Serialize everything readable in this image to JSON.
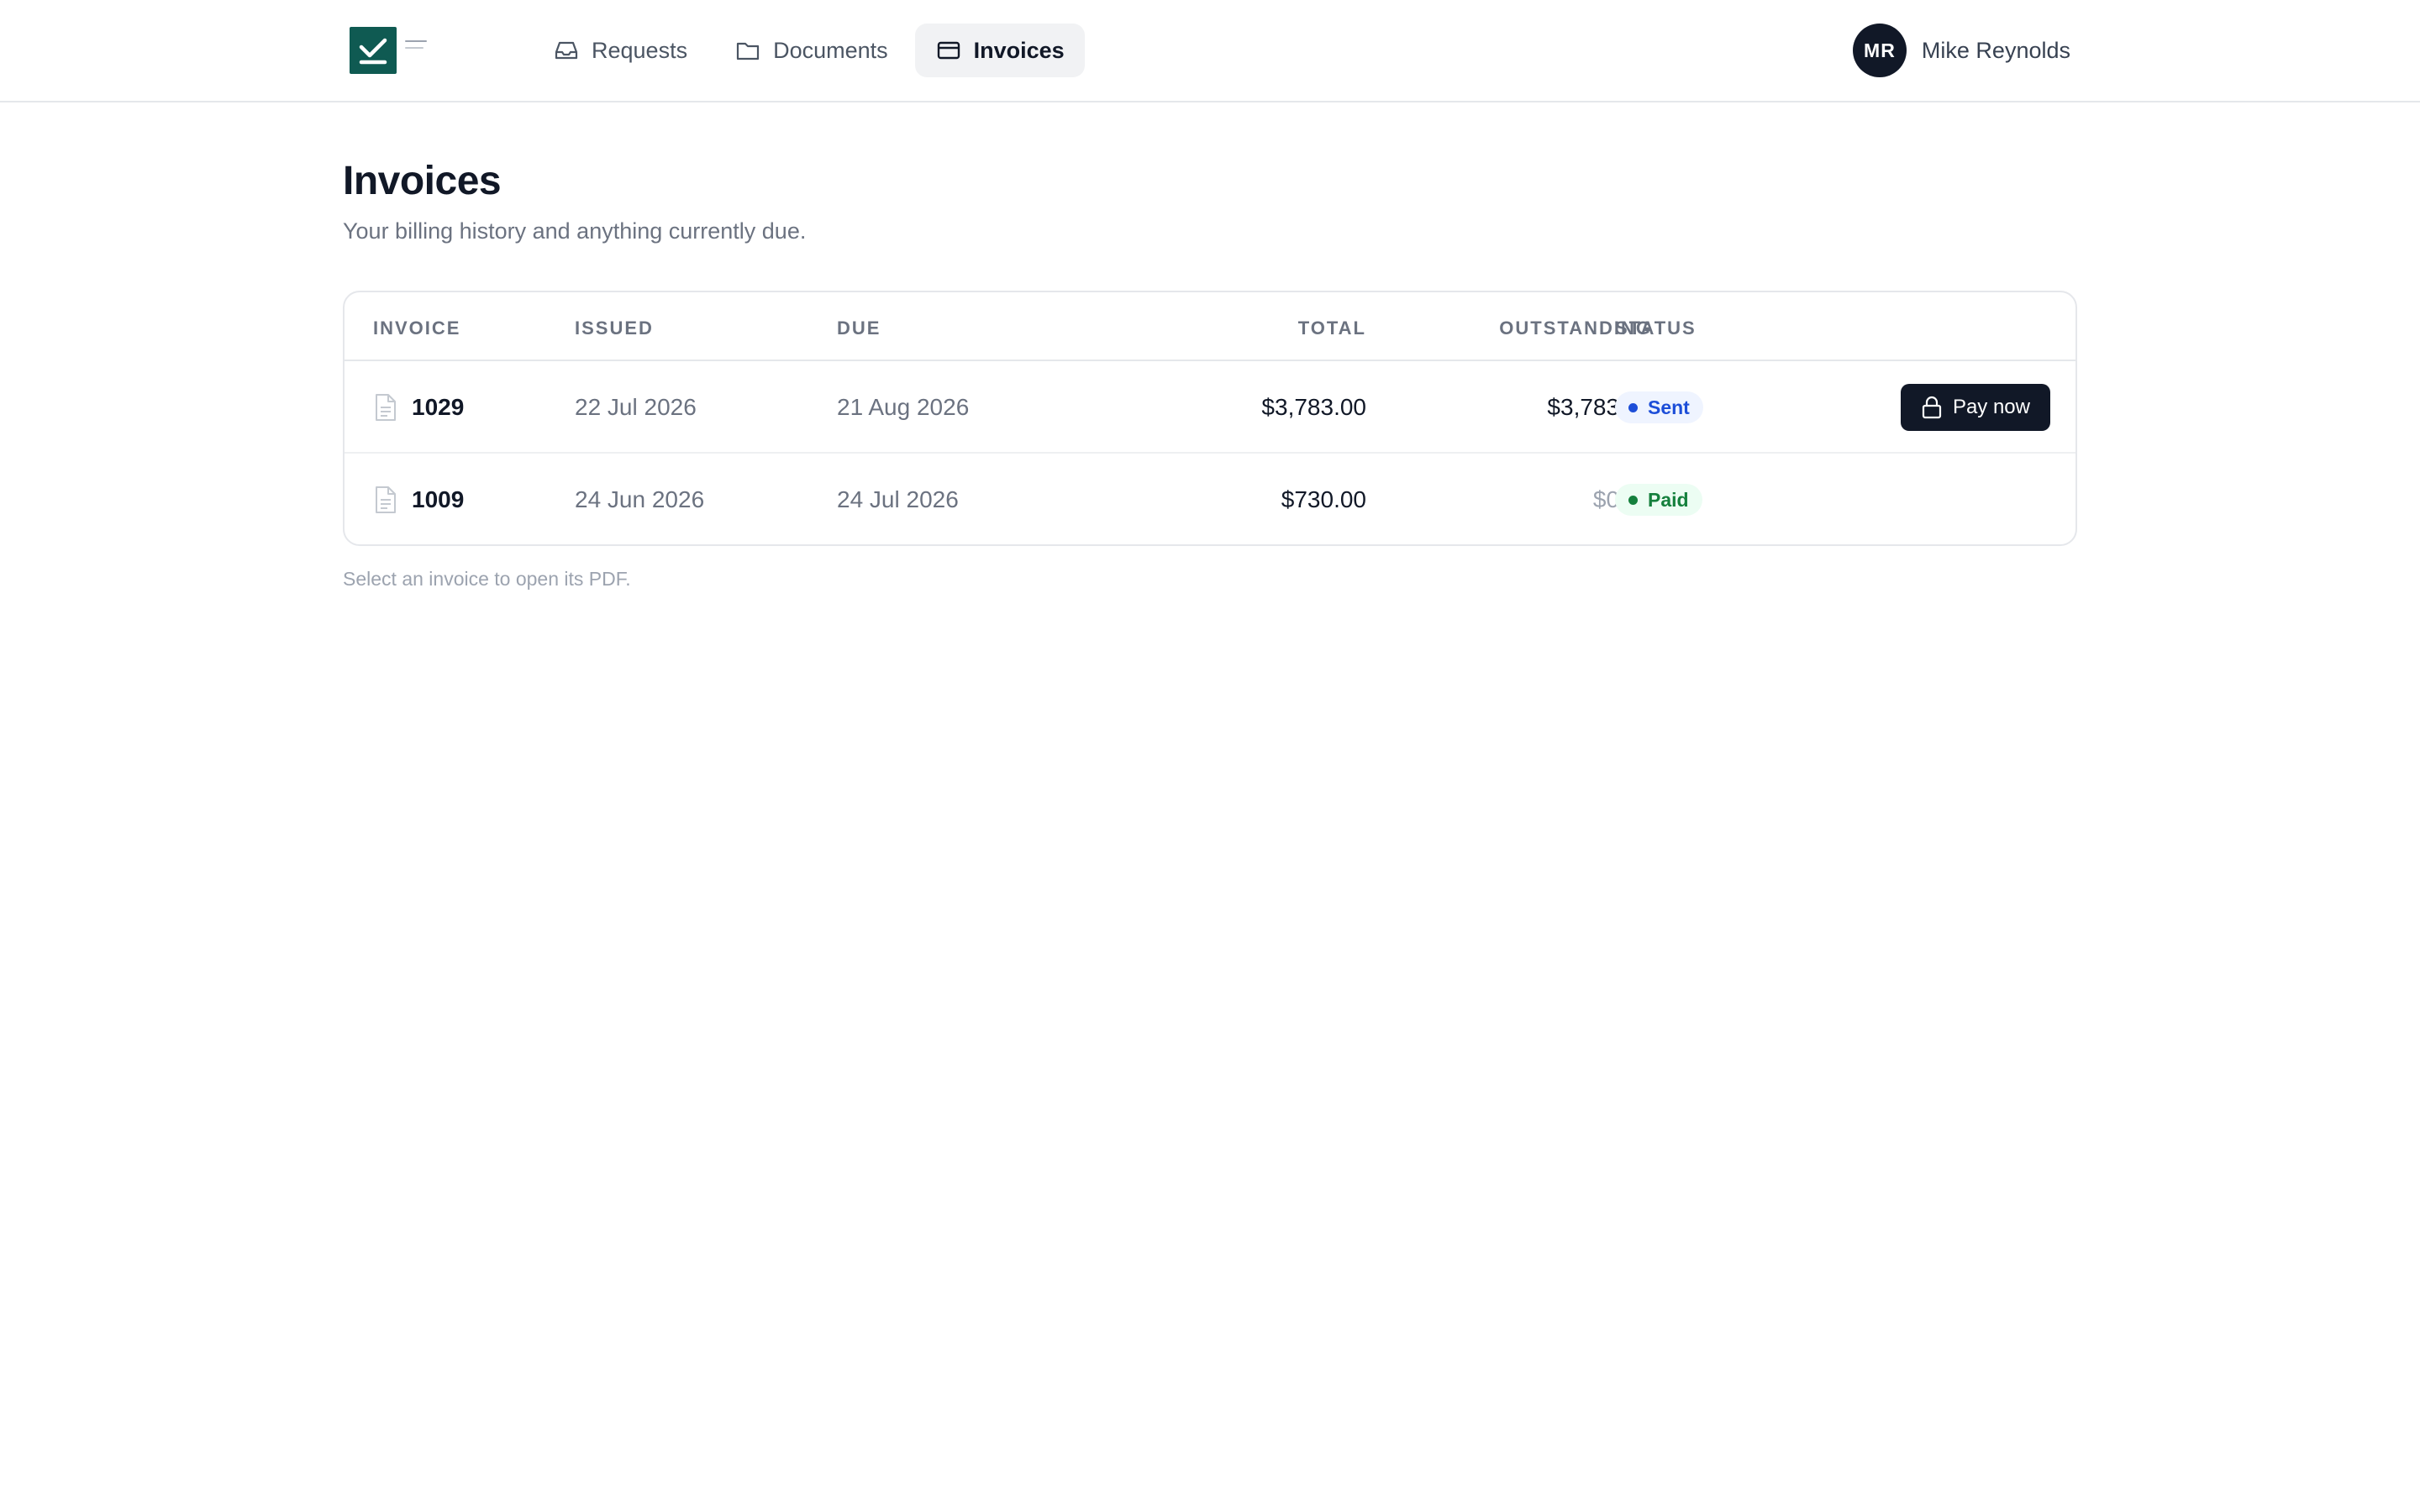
{
  "nav": {
    "items": [
      {
        "label": "Requests",
        "icon": "inbox-icon",
        "active": false
      },
      {
        "label": "Documents",
        "icon": "folder-icon",
        "active": false
      },
      {
        "label": "Invoices",
        "icon": "credit-card-icon",
        "active": true
      }
    ]
  },
  "user": {
    "initials": "MR",
    "name": "Mike Reynolds"
  },
  "page": {
    "title": "Invoices",
    "subtitle": "Your billing history and anything currently due."
  },
  "table": {
    "headers": {
      "invoice": "INVOICE",
      "issued": "ISSUED",
      "due": "DUE",
      "total": "TOTAL",
      "outstanding": "OUTSTANDING",
      "status": "STATUS"
    },
    "rows": [
      {
        "invoice": "1029",
        "issued": "22 Jul 2026",
        "due": "21 Aug 2026",
        "total": "$3,783.00",
        "outstanding": "$3,783.00",
        "status": "Sent",
        "action": "Pay now"
      },
      {
        "invoice": "1009",
        "issued": "24 Jun 2026",
        "due": "24 Jul 2026",
        "total": "$730.00",
        "outstanding": "$0.00",
        "status": "Paid"
      }
    ]
  },
  "hint": "Select an invoice to open its PDF.",
  "colors": {
    "brand": "#0f5a52",
    "dark": "#111827",
    "sent": "#1d4ed8",
    "paid": "#15803d"
  }
}
